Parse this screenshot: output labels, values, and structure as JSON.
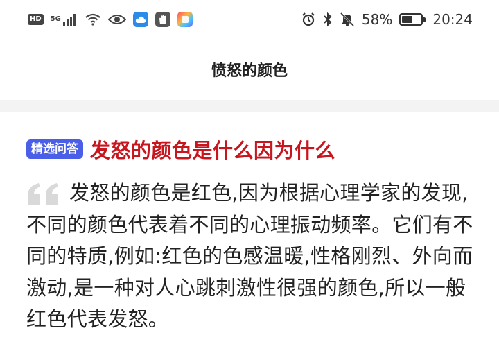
{
  "status_bar": {
    "left_icons": [
      "hd-icon",
      "5g-signal-icon",
      "wifi-icon",
      "eye-icon",
      "cloud-app-icon",
      "hand-app-icon",
      "colorful-app-icon"
    ],
    "hd_label": "HD",
    "network_label": "5G",
    "right_icons": [
      "alarm-icon",
      "bluetooth-icon",
      "mute-icon",
      "battery-icon"
    ],
    "battery_percent": "58%",
    "battery_level": 0.58,
    "time": "20:24"
  },
  "nav": {
    "title": "愤怒的颜色"
  },
  "question": {
    "badge": "精选问答",
    "title": "发怒的颜色是什么因为什么"
  },
  "answer": {
    "text": "发怒的颜色是红色,因为根据心理学家的发现,不同的颜色代表着不同的心理振动频率。它们有不同的特质,例如:红色的色感温暖,性格刚烈、外向而激动,是一种对人心跳刺激性很强的颜色,所以一般红色代表发怒。"
  },
  "colors": {
    "badge_bg": "#4a5ee8",
    "title_red": "#c8161e",
    "divider": "#f3f3f3",
    "quote_grey": "#d9d9d9"
  }
}
